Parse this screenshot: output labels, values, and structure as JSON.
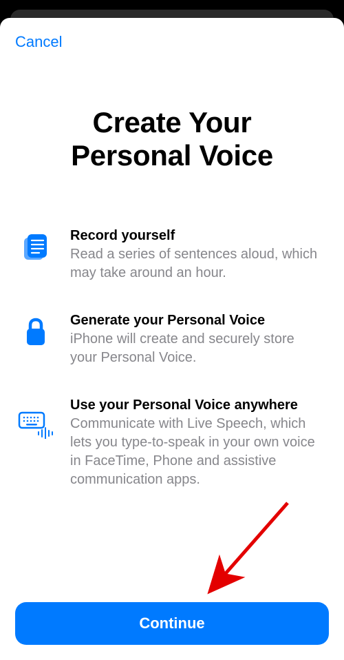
{
  "header": {
    "cancel_label": "Cancel"
  },
  "title": "Create Your\nPersonal Voice",
  "features": [
    {
      "icon": "document-stack-icon",
      "title": "Record yourself",
      "desc": "Read a series of sentences aloud, which may take around an hour."
    },
    {
      "icon": "lock-icon",
      "title": "Generate your Personal Voice",
      "desc": "iPhone will create and securely store your Personal Voice."
    },
    {
      "icon": "keyboard-voice-icon",
      "title": "Use your Personal Voice anywhere",
      "desc": "Communicate with Live Speech, which lets you type-to-speak in your own voice in FaceTime, Phone and assistive communication apps."
    }
  ],
  "continue_label": "Continue"
}
